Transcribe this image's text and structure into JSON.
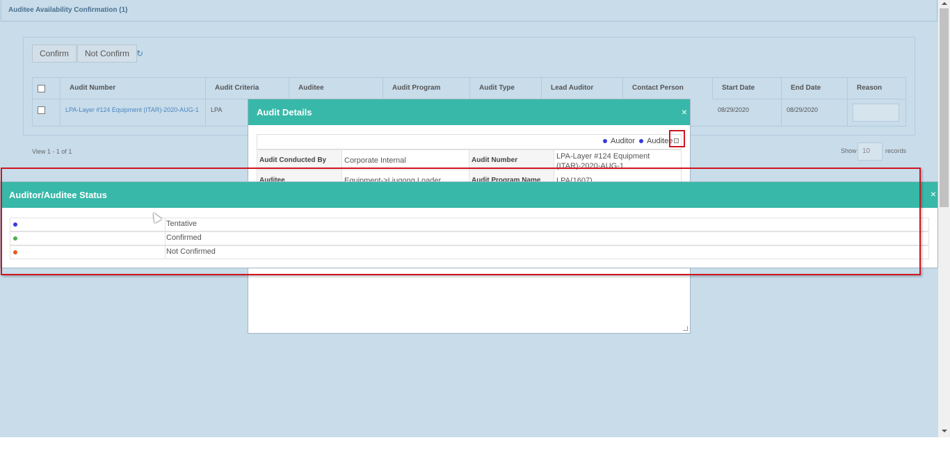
{
  "topbar": {
    "title": "Auditee Availability Confirmation (1)"
  },
  "toolbar": {
    "confirm_label": "Confirm",
    "not_confirm_label": "Not Confirm",
    "refresh_icon": "↻"
  },
  "grid": {
    "headers": [
      "Audit Number",
      "Audit Criteria",
      "Auditee",
      "Audit Program",
      "Audit Type",
      "Lead Auditor",
      "Contact Person",
      "Start Date",
      "End Date",
      "Reason"
    ],
    "row": {
      "audit_number": "LPA-Layer #124 Equipment (ITAR)-2020-AUG-1",
      "audit_criteria": "LPA",
      "start_date": "08/29/2020",
      "end_date": "08/29/2020"
    },
    "footer": {
      "view_text": "View 1 - 1 of 1",
      "show_label": "Show",
      "page_size": "10",
      "records_label": "records"
    }
  },
  "audit_details": {
    "title": "Audit Details",
    "close": "×",
    "legend": [
      {
        "label": "Auditor",
        "color": "#3a3adc"
      },
      {
        "label": "Auditee",
        "color": "#3a3adc"
      }
    ],
    "rows": [
      {
        "label1": "Audit Conducted By",
        "value1": "Corporate Internal",
        "label2": "Audit Number",
        "value2": "LPA-Layer #124 Equipment (ITAR)-2020-AUG-1"
      },
      {
        "label1": "Auditee",
        "value1": "Equipment->Liugong Loader",
        "label2": "Audit Program Name",
        "value2": "LPA(1607)"
      }
    ]
  },
  "status_dialog": {
    "title": "Auditor/Auditee Status",
    "close": "×",
    "items": [
      {
        "label": "Tentative",
        "color": "#3a3adc"
      },
      {
        "label": "Confirmed",
        "color": "#4caf50"
      },
      {
        "label": "Not Confirmed",
        "color": "#e65a1e"
      }
    ]
  }
}
